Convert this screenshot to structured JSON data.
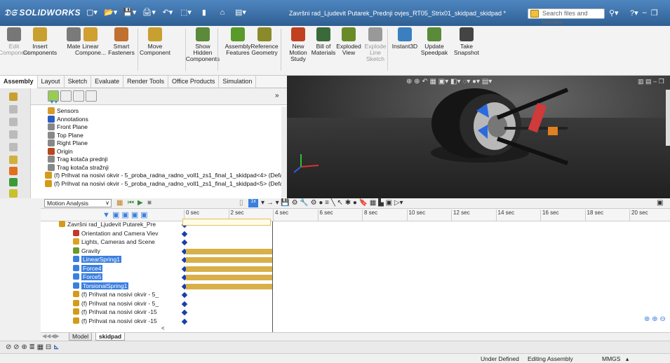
{
  "app": {
    "name": "SOLIDWORKS",
    "window_title": "Završni rad_Ljudevit Putarek_Prednji ovjes_RT05_Strix01_skidpad_skidpad *",
    "search_placeholder": "Search files and models"
  },
  "ribbon": {
    "buttons": [
      {
        "id": "edit-component",
        "label": "Edit\nComponent",
        "dim": true
      },
      {
        "id": "insert-components",
        "label": "Insert\nComponents"
      },
      {
        "id": "mate",
        "label": "Mate"
      },
      {
        "id": "linear-component",
        "label": "Linear\nCompone..."
      },
      {
        "id": "smart-fasteners",
        "label": "Smart\nFasteners"
      },
      {
        "id": "move-component",
        "label": "Move\nComponent"
      },
      {
        "id": "show-hidden-components",
        "label": "Show\nHidden\nComponents"
      },
      {
        "id": "assembly-features",
        "label": "Assembly\nFeatures"
      },
      {
        "id": "reference-geometry",
        "label": "Reference\nGeometry"
      },
      {
        "id": "new-motion-study",
        "label": "New\nMotion\nStudy"
      },
      {
        "id": "bill-of-materials",
        "label": "Bill of\nMaterials"
      },
      {
        "id": "exploded-view",
        "label": "Exploded\nView"
      },
      {
        "id": "explode-line-sketch",
        "label": "Explode\nLine\nSketch",
        "dim": true
      },
      {
        "id": "instant3d",
        "label": "Instant3D"
      },
      {
        "id": "update-speedpak",
        "label": "Update\nSpeedpak"
      },
      {
        "id": "take-snapshot",
        "label": "Take\nSnapshot"
      }
    ]
  },
  "command_tabs": [
    "Assembly",
    "Layout",
    "Sketch",
    "Evaluate",
    "Render Tools",
    "Office Products",
    "Simulation"
  ],
  "feature_tree": {
    "items": [
      {
        "label": "Sensors",
        "color": "#d89a2a"
      },
      {
        "label": "Annotations",
        "color": "#2a5fbf"
      },
      {
        "label": "Front Plane",
        "color": "#888"
      },
      {
        "label": "Top Plane",
        "color": "#888"
      },
      {
        "label": "Right Plane",
        "color": "#888"
      },
      {
        "label": "Origin",
        "color": "#b8481c"
      },
      {
        "label": "Trag kotača prednji",
        "color": "#888"
      },
      {
        "label": "Trag kotača stražnji",
        "color": "#888"
      },
      {
        "label": "(f) Prihvat na nosivi okvir - 5_proba_radna_radno_voll1_zs1_final_1_skidpad<4> (Defau",
        "color": "#d49b1a"
      },
      {
        "label": "(f) Prihvat na nosivi okvir - 5_proba_radna_radno_voll1_zs1_final_1_skidpad<5> (Defau",
        "color": "#d49b1a"
      }
    ]
  },
  "motion": {
    "study_type": "Motion Analysis",
    "time_ticks": [
      "0 sec",
      "2 sec",
      "4 sec",
      "6 sec",
      "8 sec",
      "10 sec",
      "12 sec",
      "14 sec",
      "16 sec",
      "18 sec",
      "20 sec"
    ],
    "rows": [
      {
        "label": "Završni rad_Ljudevit Putarek_Pre",
        "selected": false,
        "color": "#d49b1a",
        "bar": false
      },
      {
        "label": "Orientation and Camera Viev",
        "selected": false,
        "color": "#c0392b",
        "bar": false
      },
      {
        "label": "Lights, Cameras and Scene",
        "selected": false,
        "color": "#e0a020",
        "bar": false
      },
      {
        "label": "Gravity",
        "selected": false,
        "color": "#6a9a2a",
        "bar": true
      },
      {
        "label": "LinearSpring1",
        "selected": true,
        "color": "#3a7fdf",
        "bar": true
      },
      {
        "label": "Force4",
        "selected": true,
        "color": "#3a7fdf",
        "bar": true
      },
      {
        "label": "Force5",
        "selected": true,
        "color": "#3a7fdf",
        "bar": true
      },
      {
        "label": "TorsionalSpring1",
        "selected": true,
        "color": "#3a7fdf",
        "bar": true
      },
      {
        "label": "(f) Prihvat na nosivi okvir - 5_",
        "selected": false,
        "color": "#d49b1a",
        "bar": false
      },
      {
        "label": "(f) Prihvat na nosivi okvir - 5_",
        "selected": false,
        "color": "#d49b1a",
        "bar": false
      },
      {
        "label": "(f) Prihvat na nosivi okvir -15",
        "selected": false,
        "color": "#d49b1a",
        "bar": false
      },
      {
        "label": "(f) Prihvat na nosivi okvir -15",
        "selected": false,
        "color": "#d49b1a",
        "bar": false
      }
    ],
    "bottom_tabs": [
      "Model",
      "skidpad"
    ]
  },
  "status": {
    "state": "Under Defined",
    "mode": "Editing Assembly",
    "units": "MMGS"
  }
}
